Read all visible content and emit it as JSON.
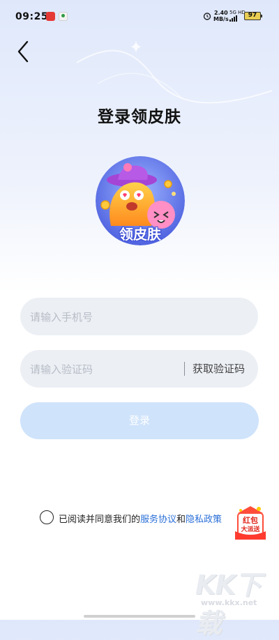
{
  "status_bar": {
    "time": "09:25",
    "net_speed_value": "2.40",
    "net_speed_unit": "MB/s",
    "network": "5G HD",
    "battery": "97"
  },
  "header": {
    "back_icon": "chevron-left-icon"
  },
  "page": {
    "title": "登录领皮肤",
    "logo_label": "领皮肤"
  },
  "form": {
    "phone_placeholder": "请输入手机号",
    "phone_value": "",
    "code_placeholder": "请输入验证码",
    "code_value": "",
    "get_code_label": "获取验证码",
    "login_label": "登录"
  },
  "agreement": {
    "prefix": "已阅读并同意我们的",
    "service_link": "服务协议",
    "and": "和",
    "privacy_link": "隐私政策",
    "checked": false
  },
  "promo": {
    "line1": "红包",
    "line2": "大派送"
  },
  "watermark": {
    "text": "KK下载",
    "url": "www.kkx.net"
  },
  "colors": {
    "link": "#2a6fd8",
    "login_button_disabled": "#cfe3fb",
    "field_bg": "#eceff4"
  }
}
